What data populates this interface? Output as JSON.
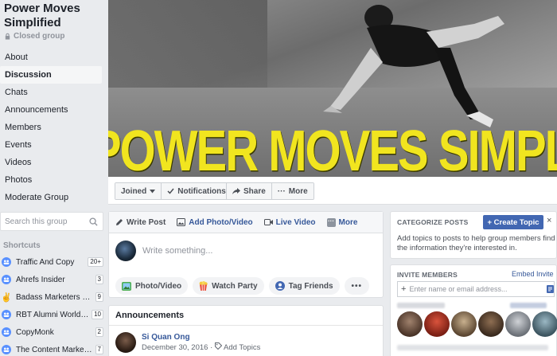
{
  "group": {
    "name": "Power Moves Simplified",
    "privacy": "Closed group"
  },
  "nav": [
    {
      "label": "About",
      "active": false
    },
    {
      "label": "Discussion",
      "active": true
    },
    {
      "label": "Chats",
      "active": false
    },
    {
      "label": "Announcements",
      "active": false
    },
    {
      "label": "Members",
      "active": false
    },
    {
      "label": "Events",
      "active": false
    },
    {
      "label": "Videos",
      "active": false
    },
    {
      "label": "Photos",
      "active": false
    },
    {
      "label": "Moderate Group",
      "active": false
    }
  ],
  "search": {
    "placeholder": "Search this group"
  },
  "shortcuts": {
    "title": "Shortcuts",
    "items": [
      {
        "label": "Traffic And Copy",
        "badge": "20+",
        "icon": "group-icon"
      },
      {
        "label": "Ahrefs Insider",
        "badge": "3",
        "icon": "group-icon"
      },
      {
        "label": "Badass Marketers & ...",
        "badge": "9",
        "icon": "hand-icon"
      },
      {
        "label": "RBT Alumni Worldw...",
        "badge": "10",
        "icon": "group-icon"
      },
      {
        "label": "CopyMonk",
        "badge": "2",
        "icon": "group-icon"
      },
      {
        "label": "The Content Marketi...",
        "badge": "7",
        "icon": "group-icon"
      }
    ]
  },
  "cover": {
    "banner_text": "POWER MOVES SIMPLIFIED"
  },
  "cover_actions": {
    "joined": "Joined",
    "notifications": "Notifications",
    "share": "Share",
    "more": "More"
  },
  "composer": {
    "tabs": {
      "write_post": "Write Post",
      "add_photo_video": "Add Photo/Video",
      "live_video": "Live Video",
      "more": "More"
    },
    "placeholder": "Write something...",
    "actions": {
      "photo_video": "Photo/Video",
      "watch_party": "Watch Party",
      "tag_friends": "Tag Friends"
    }
  },
  "announcements": {
    "title": "Announcements",
    "post": {
      "author": "Si Quan Ong",
      "date": "December 30, 2016",
      "add_topics": "Add Topics"
    }
  },
  "categorize": {
    "title": "CATEGORIZE POSTS",
    "create_button": "+ Create Topic",
    "close": "×",
    "description": "Add topics to posts to help group members find the information they're interested in."
  },
  "invite": {
    "title": "INVITE MEMBERS",
    "embed": "Embed Invite",
    "placeholder": "Enter name or email address..."
  },
  "colors": {
    "brand": "#4267b2",
    "link": "#365899",
    "banner_yellow": "#f1e51f",
    "page_bg": "#e9ebee"
  }
}
